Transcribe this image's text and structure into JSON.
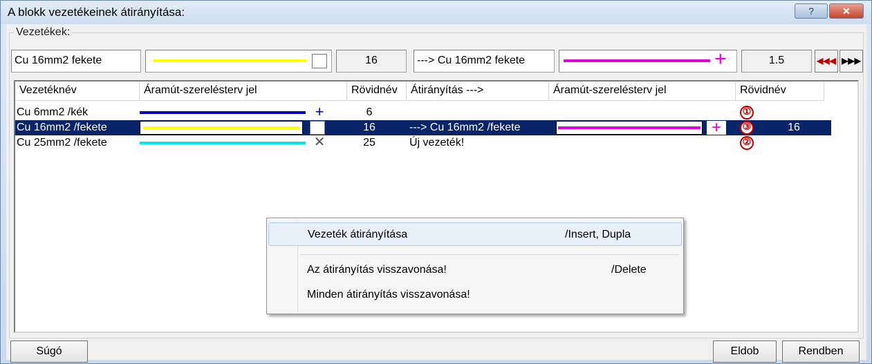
{
  "window": {
    "title": "A blokk vezetékeinek átirányítása:",
    "help_glyph": "?",
    "close_glyph": "✕"
  },
  "group": {
    "label": "Vezetékek:"
  },
  "top": {
    "source_name": "Cu 16mm2 fekete",
    "source_short": "16",
    "target_name": "---> Cu 16mm2 fekete",
    "target_short": "1.5",
    "prev_glyph": "◀◀◀",
    "next_glyph": "▶▶▶"
  },
  "columns": [
    "Vezetéknév",
    "Áramút-szerelésterv jel",
    "Rövidnév",
    "Átirányítás --->",
    "Áramút-szerelésterv jel",
    "Rövidnév"
  ],
  "rows": [
    {
      "name": "Cu 6mm2 /kék",
      "color": "#0000c0",
      "marker": "+",
      "short": "6",
      "redirect": "",
      "badge": "①",
      "target_short": ""
    },
    {
      "name": "Cu 16mm2 /fekete",
      "color": "#ffff00",
      "marker": "□",
      "short": "16",
      "redirect": "---> Cu 16mm2 /fekete",
      "badge": "③",
      "target_short": "16"
    },
    {
      "name": "Cu 25mm2 /fekete",
      "color": "#00e5ee",
      "marker": "✕",
      "short": "25",
      "redirect": "Új vezeték!",
      "badge": "②",
      "target_short": ""
    }
  ],
  "colors": {
    "target_line": "#e000e0",
    "selection": "#0a246a",
    "badge": "#c00000"
  },
  "menu": {
    "items": [
      {
        "label": "Vezeték átirányítása",
        "shortcut": "/Insert, Dupla"
      },
      {
        "label": "Az átirányítás visszavonása!",
        "shortcut": "/Delete"
      },
      {
        "label": "Minden átirányítás visszavonása!",
        "shortcut": ""
      }
    ]
  },
  "buttons": {
    "help": "Súgó",
    "cancel": "Eldob",
    "ok": "Rendben"
  }
}
